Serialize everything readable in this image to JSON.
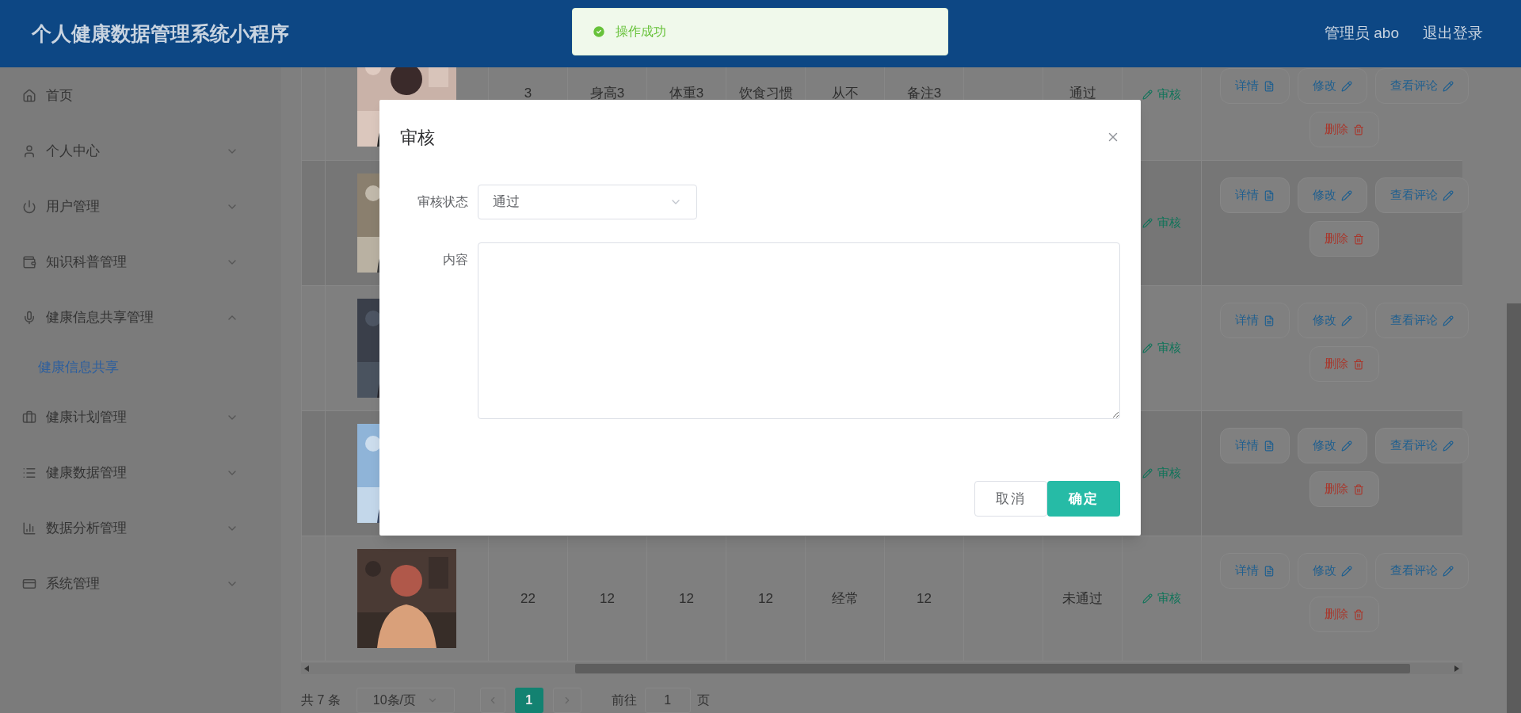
{
  "header": {
    "title": "个人健康数据管理系统小程序",
    "user": "管理员 abo",
    "logout": "退出登录"
  },
  "toast": {
    "text": "操作成功"
  },
  "sidebar": {
    "items": [
      {
        "label": "首页"
      },
      {
        "label": "个人中心",
        "expanded": false
      },
      {
        "label": "用户管理",
        "expanded": false
      },
      {
        "label": "知识科普管理",
        "expanded": false
      },
      {
        "label": "健康信息共享管理",
        "expanded": true,
        "children": [
          {
            "label": "健康信息共享",
            "selected": true
          }
        ]
      },
      {
        "label": "健康计划管理",
        "expanded": false
      },
      {
        "label": "健康数据管理",
        "expanded": false
      },
      {
        "label": "数据分析管理",
        "expanded": false
      },
      {
        "label": "系统管理",
        "expanded": false
      }
    ]
  },
  "table": {
    "rows": [
      {
        "image": {
          "kind": "picture"
        },
        "cells": [
          "3",
          "身高3",
          "体重3",
          "饮食习惯",
          "从不",
          "备注3"
        ],
        "status": "通过",
        "review_link": "审核",
        "actions": [
          {
            "label": "详情",
            "kind": "detail"
          },
          {
            "label": "修改",
            "kind": "edit"
          },
          {
            "label": "查看评论",
            "kind": "comment"
          },
          {
            "label": "删除",
            "kind": "delete"
          }
        ]
      },
      {
        "image": {
          "kind": "picture"
        },
        "review_link": "审核",
        "actions": [
          {
            "label": "详情",
            "kind": "detail"
          },
          {
            "label": "修改",
            "kind": "edit"
          },
          {
            "label": "查看评论",
            "kind": "comment"
          },
          {
            "label": "删除",
            "kind": "delete"
          }
        ]
      },
      {
        "image": {
          "kind": "picture"
        },
        "review_link": "审核",
        "actions": [
          {
            "label": "详情",
            "kind": "detail"
          },
          {
            "label": "修改",
            "kind": "edit"
          },
          {
            "label": "查看评论",
            "kind": "comment"
          },
          {
            "label": "删除",
            "kind": "delete"
          }
        ]
      },
      {
        "image": {
          "kind": "picture"
        },
        "review_link": "审核",
        "actions": [
          {
            "label": "详情",
            "kind": "detail"
          },
          {
            "label": "修改",
            "kind": "edit"
          },
          {
            "label": "查看评论",
            "kind": "comment"
          },
          {
            "label": "删除",
            "kind": "delete"
          }
        ]
      },
      {
        "image": {
          "kind": "picture"
        },
        "cells": [
          "22",
          "12",
          "12",
          "12",
          "经常",
          "12"
        ],
        "status": "未通过",
        "review_link": "审核",
        "actions": [
          {
            "label": "详情",
            "kind": "detail"
          },
          {
            "label": "修改",
            "kind": "edit"
          },
          {
            "label": "查看评论",
            "kind": "comment"
          },
          {
            "label": "删除",
            "kind": "delete"
          }
        ]
      }
    ]
  },
  "pagination": {
    "total": "共 7 条",
    "page_size": "10条/页",
    "pages": [
      {
        "label": "1",
        "selected": true
      }
    ],
    "goto_label": "前往",
    "goto_value": "1",
    "goto_suffix": "页"
  },
  "dialog": {
    "title": "审核",
    "fields": [
      {
        "label": "审核状态",
        "kind": "select",
        "value": "通过"
      },
      {
        "label": "内容",
        "kind": "textarea"
      }
    ],
    "buttons": [
      {
        "label": "取消",
        "kind": "cancel"
      },
      {
        "label": "确定",
        "kind": "primary"
      }
    ]
  }
}
